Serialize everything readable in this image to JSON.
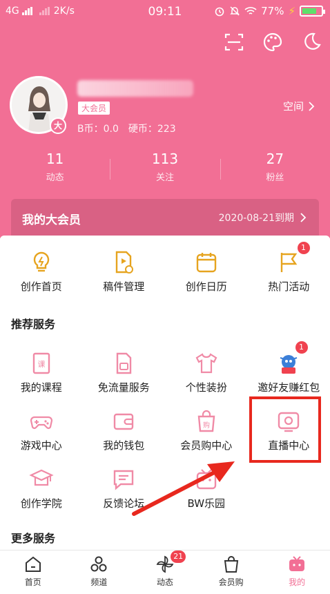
{
  "status_bar": {
    "network": "4G",
    "speed": "2K/s",
    "time": "09:11",
    "battery": "77%",
    "battery_level": 0.77
  },
  "profile": {
    "vip_tag": "大会员",
    "avatar_badge": "大",
    "b_coin": "B币：0.0",
    "hard_coin": "硬币：223",
    "space_label": "空间"
  },
  "stats": [
    {
      "num": "11",
      "label": "动态"
    },
    {
      "num": "113",
      "label": "关注"
    },
    {
      "num": "27",
      "label": "粉丝"
    }
  ],
  "vip_bar": {
    "title": "我的大会员",
    "expiry": "2020-08-21到期"
  },
  "creation": [
    {
      "label": "创作首页",
      "icon": "bulb-icon"
    },
    {
      "label": "稿件管理",
      "icon": "video-file-icon"
    },
    {
      "label": "创作日历",
      "icon": "calendar-icon"
    },
    {
      "label": "热门活动",
      "icon": "flag-icon",
      "badge": "1"
    }
  ],
  "recommended": {
    "title": "推荐服务",
    "rows": [
      [
        {
          "label": "我的课程",
          "icon": "course-book-icon"
        },
        {
          "label": "免流量服务",
          "icon": "sim-card-icon"
        },
        {
          "label": "个性装扮",
          "icon": "tshirt-icon"
        },
        {
          "label": "邀好友赚红包",
          "icon": "mascot-icon",
          "badge": "1"
        }
      ],
      [
        {
          "label": "游戏中心",
          "icon": "gamepad-icon"
        },
        {
          "label": "我的钱包",
          "icon": "wallet-icon"
        },
        {
          "label": "会员购中心",
          "icon": "shopping-bag-icon"
        },
        {
          "label": "直播中心",
          "icon": "live-tv-icon"
        }
      ],
      [
        {
          "label": "创作学院",
          "icon": "graduation-cap-icon"
        },
        {
          "label": "反馈论坛",
          "icon": "chat-icon"
        },
        {
          "label": "BW乐园",
          "icon": "bw-park-icon"
        }
      ]
    ]
  },
  "more_services_title": "更多服务",
  "bottom_nav": [
    {
      "label": "首页",
      "icon": "home-icon"
    },
    {
      "label": "频道",
      "icon": "channel-icon"
    },
    {
      "label": "动态",
      "icon": "pinwheel-icon",
      "badge": "21"
    },
    {
      "label": "会员购",
      "icon": "bag-icon"
    },
    {
      "label": "我的",
      "icon": "tv-mine-icon",
      "active": true
    }
  ],
  "colors": {
    "brand_pink": "#f26f95",
    "icon_gold": "#e6a41f",
    "icon_pink": "#f08aa6",
    "badge_red": "#f0424f",
    "highlight_red": "#e8281e"
  }
}
